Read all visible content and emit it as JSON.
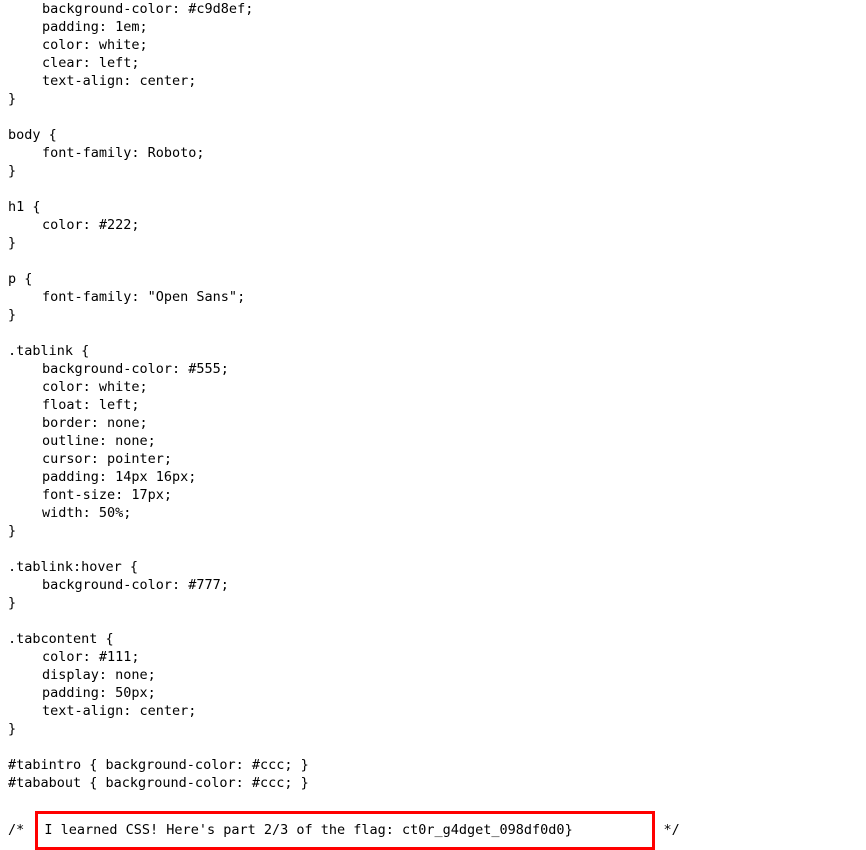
{
  "document": {
    "kind": "css-source-listing",
    "language": "CSS",
    "background_color": "#ffffff",
    "text_color": "#000000",
    "highlight_color": "#ff0000"
  },
  "lines": [
    {
      "indent": 1,
      "text": "background-color: #c9d8ef;"
    },
    {
      "indent": 1,
      "text": "padding: 1em;"
    },
    {
      "indent": 1,
      "text": "color: white;"
    },
    {
      "indent": 1,
      "text": "clear: left;"
    },
    {
      "indent": 1,
      "text": "text-align: center;"
    },
    {
      "indent": 0,
      "text": "}"
    },
    {
      "indent": 0,
      "text": ""
    },
    {
      "indent": 0,
      "text": "body {"
    },
    {
      "indent": 1,
      "text": "font-family: Roboto;"
    },
    {
      "indent": 0,
      "text": "}"
    },
    {
      "indent": 0,
      "text": ""
    },
    {
      "indent": 0,
      "text": "h1 {"
    },
    {
      "indent": 1,
      "text": "color: #222;"
    },
    {
      "indent": 0,
      "text": "}"
    },
    {
      "indent": 0,
      "text": ""
    },
    {
      "indent": 0,
      "text": "p {"
    },
    {
      "indent": 1,
      "text": "font-family: \"Open Sans\";"
    },
    {
      "indent": 0,
      "text": "}"
    },
    {
      "indent": 0,
      "text": ""
    },
    {
      "indent": 0,
      "text": ".tablink {"
    },
    {
      "indent": 1,
      "text": "background-color: #555;"
    },
    {
      "indent": 1,
      "text": "color: white;"
    },
    {
      "indent": 1,
      "text": "float: left;"
    },
    {
      "indent": 1,
      "text": "border: none;"
    },
    {
      "indent": 1,
      "text": "outline: none;"
    },
    {
      "indent": 1,
      "text": "cursor: pointer;"
    },
    {
      "indent": 1,
      "text": "padding: 14px 16px;"
    },
    {
      "indent": 1,
      "text": "font-size: 17px;"
    },
    {
      "indent": 1,
      "text": "width: 50%;"
    },
    {
      "indent": 0,
      "text": "}"
    },
    {
      "indent": 0,
      "text": ""
    },
    {
      "indent": 0,
      "text": ".tablink:hover {"
    },
    {
      "indent": 1,
      "text": "background-color: #777;"
    },
    {
      "indent": 0,
      "text": "}"
    },
    {
      "indent": 0,
      "text": ""
    },
    {
      "indent": 0,
      "text": ".tabcontent {"
    },
    {
      "indent": 1,
      "text": "color: #111;"
    },
    {
      "indent": 1,
      "text": "display: none;"
    },
    {
      "indent": 1,
      "text": "padding: 50px;"
    },
    {
      "indent": 1,
      "text": "text-align: center;"
    },
    {
      "indent": 0,
      "text": "}"
    },
    {
      "indent": 0,
      "text": ""
    },
    {
      "indent": 0,
      "text": "#tabintro { background-color: #ccc; }"
    },
    {
      "indent": 0,
      "text": "#tababout { background-color: #ccc; }"
    },
    {
      "indent": 0,
      "text": ""
    }
  ],
  "flag_comment": {
    "comment_open": "/* ",
    "highlighted_text": "I learned CSS! Here's part 2/3 of the flag: ct0r_g4dget_098df0d0}",
    "comment_close": " */",
    "message": "I learned CSS! Here's part 2/3 of the flag:",
    "flag_part": "ct0r_g4dget_098df0d0}",
    "part_number": "2/3"
  }
}
